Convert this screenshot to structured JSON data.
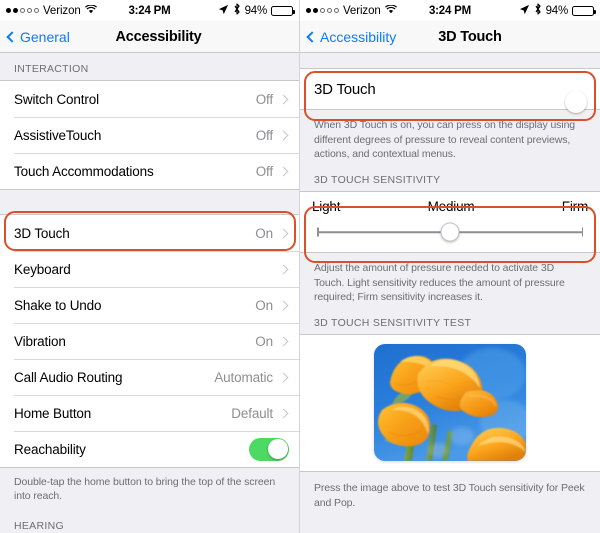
{
  "status_bar": {
    "carrier": "Verizon",
    "signal_filled": 2,
    "signal_total": 5,
    "wifi_icon": "wifi-icon",
    "time": "3:24 PM",
    "location_icon": "location-arrow-icon",
    "bluetooth_icon": "bluetooth-icon",
    "battery_percent": "94%",
    "battery_icon": "battery-icon"
  },
  "left_panel": {
    "nav": {
      "back_label": "General",
      "back_icon": "chevron-left-icon",
      "title": "Accessibility"
    },
    "section_interaction": {
      "header": "INTERACTION",
      "rows": [
        {
          "label": "Switch Control",
          "value": "Off",
          "accessory": "chevron-right-icon"
        },
        {
          "label": "AssistiveTouch",
          "value": "Off",
          "accessory": "chevron-right-icon"
        },
        {
          "label": "Touch Accommodations",
          "value": "Off",
          "accessory": "chevron-right-icon"
        }
      ]
    },
    "section_interaction_2": {
      "rows": [
        {
          "label": "3D Touch",
          "value": "On",
          "accessory": "chevron-right-icon",
          "highlighted": true
        },
        {
          "label": "Keyboard",
          "value": "",
          "accessory": "chevron-right-icon"
        },
        {
          "label": "Shake to Undo",
          "value": "On",
          "accessory": "chevron-right-icon"
        },
        {
          "label": "Vibration",
          "value": "On",
          "accessory": "chevron-right-icon"
        },
        {
          "label": "Call Audio Routing",
          "value": "Automatic",
          "accessory": "chevron-right-icon"
        },
        {
          "label": "Home Button",
          "value": "Default",
          "accessory": "chevron-right-icon"
        },
        {
          "label": "Reachability",
          "value": "",
          "accessory": "toggle-on"
        }
      ]
    },
    "reachability_note": "Double-tap the home button to bring the top of the screen into reach.",
    "section_hearing_header": "HEARING"
  },
  "right_panel": {
    "nav": {
      "back_label": "Accessibility",
      "back_icon": "chevron-left-icon",
      "title": "3D Touch"
    },
    "main_toggle": {
      "label": "3D Touch",
      "state": "on",
      "highlighted": true
    },
    "main_description": "When 3D Touch is on, you can press on the display using different degrees of pressure to reveal content previews, actions, and contextual menus.",
    "sensitivity": {
      "header": "3D TOUCH SENSITIVITY",
      "label_left": "Light",
      "label_center": "Medium",
      "label_right": "Firm",
      "value_percent": 50,
      "highlighted": true
    },
    "sensitivity_description": "Adjust the amount of pressure needed to activate 3D Touch. Light sensitivity reduces the amount of pressure required; Firm sensitivity increases it.",
    "test": {
      "header": "3D TOUCH SENSITIVITY TEST",
      "image_alt": "orange-poppy-flowers-photo",
      "footer": "Press the image above to test 3D Touch sensitivity for Peek and Pop."
    }
  },
  "colors": {
    "accent_blue": "#0a7cff",
    "toggle_green": "#4cd964",
    "highlight_orange": "#d9502a",
    "group_bg": "#efeff4",
    "secondary_text": "#8e8e93"
  }
}
